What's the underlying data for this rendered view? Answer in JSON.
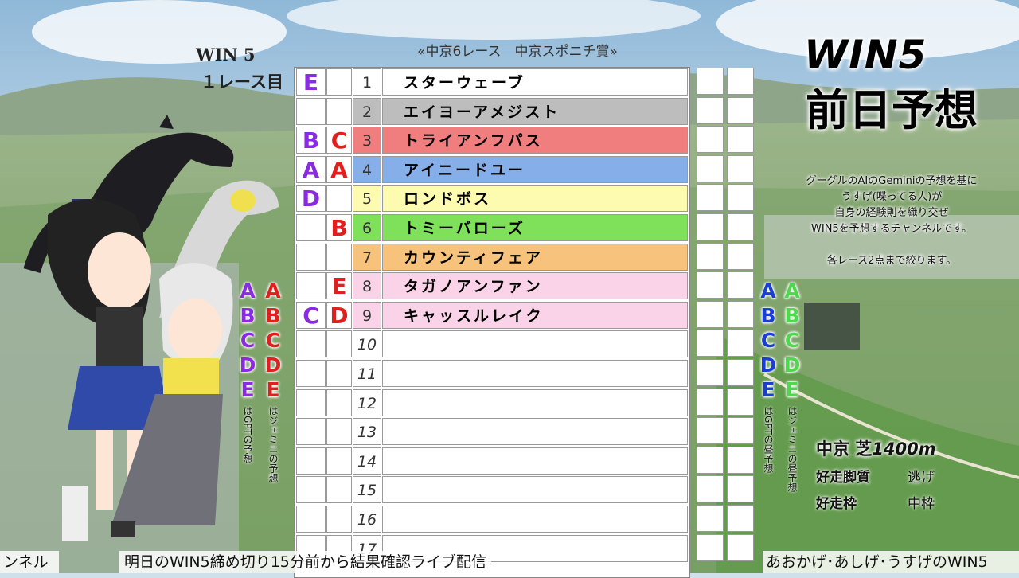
{
  "header": {
    "race_title": "«中京6レース　中京スポニチ賞»",
    "win5_label": "WIN 5",
    "race_number": "１レース目"
  },
  "title": {
    "line1": "WIN5",
    "line2": "前日予想"
  },
  "description": [
    "グーグルのAIのGeminiの予想を基に",
    "うすげ(喋ってる人)が",
    "自身の経験則を織り交ぜ",
    "WIN5を予想するチャンネルです。",
    "",
    "各レース2点まで絞ります。"
  ],
  "course": {
    "venue": "中京",
    "surface": "芝",
    "distance": "1400m",
    "running_style_label": "好走脚質",
    "running_style_value": "逃げ",
    "gate_label": "好走枠",
    "gate_value": "中枠"
  },
  "colors": {
    "gpt": "#8a2be2",
    "gemini": "#e0201e",
    "gpt_noon": "#1a3fd0",
    "gemini_noon": "#4ed84e"
  },
  "rows": [
    {
      "num": "1",
      "name": "スターウェーブ",
      "pick1": "E",
      "pick2": "",
      "color": "#ffffff"
    },
    {
      "num": "2",
      "name": "エイヨーアメジスト",
      "pick1": "",
      "pick2": "",
      "color": "#bdbdbd"
    },
    {
      "num": "3",
      "name": "トライアンフパス",
      "pick1": "B",
      "pick2": "C",
      "color": "#f07e7e"
    },
    {
      "num": "4",
      "name": "アイニードユー",
      "pick1": "A",
      "pick2": "A",
      "color": "#86aee8"
    },
    {
      "num": "5",
      "name": "ロンドボス",
      "pick1": "D",
      "pick2": "",
      "color": "#fdfbb0"
    },
    {
      "num": "6",
      "name": "トミーバローズ",
      "pick1": "",
      "pick2": "B",
      "color": "#7fe05a"
    },
    {
      "num": "7",
      "name": "カウンティフェア",
      "pick1": "",
      "pick2": "",
      "color": "#f7c37c"
    },
    {
      "num": "8",
      "name": "タガノアンファン",
      "pick1": "",
      "pick2": "E",
      "color": "#fbd3e9"
    },
    {
      "num": "9",
      "name": "キャッスルレイク",
      "pick1": "C",
      "pick2": "D",
      "color": "#fbd3e9"
    },
    {
      "num": "10",
      "name": "",
      "pick1": "",
      "pick2": "",
      "color": "#ffffff"
    },
    {
      "num": "11",
      "name": "",
      "pick1": "",
      "pick2": "",
      "color": "#ffffff"
    },
    {
      "num": "12",
      "name": "",
      "pick1": "",
      "pick2": "",
      "color": "#ffffff"
    },
    {
      "num": "13",
      "name": "",
      "pick1": "",
      "pick2": "",
      "color": "#ffffff"
    },
    {
      "num": "14",
      "name": "",
      "pick1": "",
      "pick2": "",
      "color": "#ffffff"
    },
    {
      "num": "15",
      "name": "",
      "pick1": "",
      "pick2": "",
      "color": "#ffffff"
    },
    {
      "num": "16",
      "name": "",
      "pick1": "",
      "pick2": "",
      "color": "#ffffff"
    },
    {
      "num": "17",
      "name": "",
      "pick1": "",
      "pick2": "",
      "color": "#ffffff"
    }
  ],
  "legend": {
    "gpt_letters": [
      "A",
      "B",
      "C",
      "D",
      "E"
    ],
    "gpt_note": "はGPTの予想",
    "gemini_letters": [
      "A",
      "B",
      "C",
      "D",
      "E"
    ],
    "gemini_note": "はジェミニの予想",
    "gpt_noon_letters": [
      "A",
      "B",
      "C",
      "D",
      "E"
    ],
    "gpt_noon_note": "はGPTの昼予想",
    "gemini_noon_letters": [
      "A",
      "B",
      "C",
      "D",
      "E"
    ],
    "gemini_noon_note": "はジェミニの昼予想"
  },
  "ticker": {
    "left": "ンネル",
    "center": "明日のWIN5締め切り15分前から結果確認ライブ配信",
    "right": "あおかげ･あしげ･うすげのWIN5"
  }
}
